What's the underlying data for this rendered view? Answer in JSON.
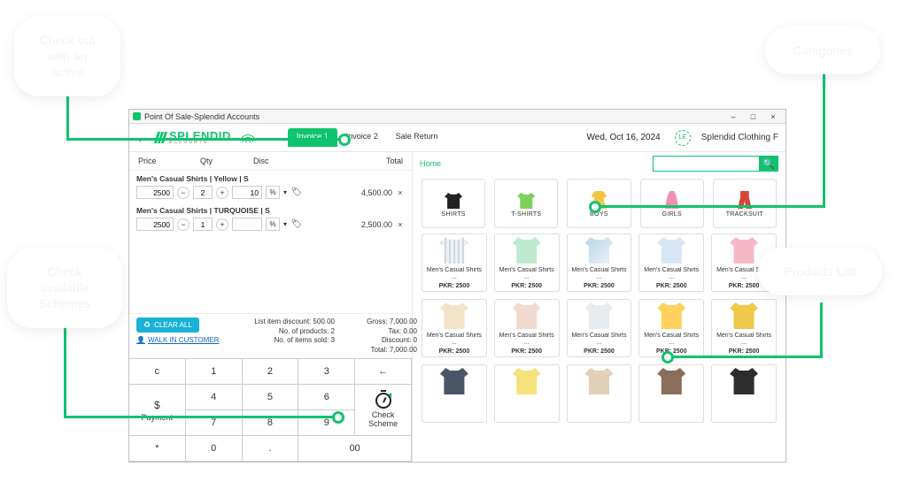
{
  "callouts": {
    "top_left": "Check out\nwith an active",
    "top_right": "Categories",
    "mid_left": "Check available\nSchemes",
    "mid_right": "Products List"
  },
  "window": {
    "title": "Point Of Sale-Splendid Accounts",
    "min": "–",
    "max": "□",
    "close": "×"
  },
  "header": {
    "back": "←",
    "brand": "SPLENDID",
    "brand_sub": "ACCOUNTS",
    "tabs": [
      "Invoice 1",
      "Invoice 2",
      "Sale Return"
    ],
    "active_tab": 0,
    "date": "Wed, Oct 16, 2024",
    "merchant_badge": "LE",
    "merchant_name": "Splendid Clothing F"
  },
  "cart": {
    "columns": {
      "price": "Price",
      "qty": "Qty",
      "disc": "Disc",
      "total": "Total"
    },
    "items": [
      {
        "name": "Men's Casual Shirts | Yellow | S",
        "price": "2500",
        "qty": "2",
        "disc": "10",
        "disc_type": "%",
        "total": "4,500.00"
      },
      {
        "name": "Men's Casual Shirts | TURQUOISE | S",
        "price": "2500",
        "qty": "1",
        "disc": "",
        "disc_type": "%",
        "total": "2,500.00"
      }
    ]
  },
  "summary": {
    "clear_all": "CLEAR ALL",
    "customer": "WALK IN CUSTOMER",
    "mid": {
      "list_disc_label": "List item discount:",
      "list_disc_value": "500.00",
      "num_products_label": "No. of products:",
      "num_products_value": "2",
      "items_sold_label": "No. of items sold:",
      "items_sold_value": "3"
    },
    "right": {
      "gross_label": "Gross:",
      "gross_value": "7,000.00",
      "tax_label": "Tax:",
      "tax_value": "0.00",
      "discount_label": "Discount:",
      "discount_value": "0",
      "total_label": "Total:",
      "total_value": "7,000.00"
    }
  },
  "keypad": {
    "keys": [
      "c",
      "1",
      "2",
      "3",
      "←",
      "4",
      "5",
      "6",
      "7",
      "8",
      "9",
      "*",
      "0",
      ".",
      "00"
    ],
    "payment": "Payment",
    "check_scheme": "Check\nScheme"
  },
  "breadcrumb": "Home",
  "search": {
    "placeholder": ""
  },
  "categories": [
    {
      "label": "SHIRTS"
    },
    {
      "label": "T-SHIRTS"
    },
    {
      "label": "BOYS"
    },
    {
      "label": "GIRLS"
    },
    {
      "label": "TRACKSUIT"
    }
  ],
  "products": [
    {
      "name": "Men's Casual Shirts ...",
      "price": "PKR: 2500"
    },
    {
      "name": "Men's Casual Shirts ...",
      "price": "PKR: 2500"
    },
    {
      "name": "Men's Casual Shirts ...",
      "price": "PKR: 2500"
    },
    {
      "name": "Men's Casual Shirts ...",
      "price": "PKR: 2500"
    },
    {
      "name": "Men's Casual Shirts ...",
      "price": "PKR: 2500"
    },
    {
      "name": "Men's Casual Shirts ...",
      "price": "PKR: 2500"
    },
    {
      "name": "Men's Casual Shirts ...",
      "price": "PKR: 2500"
    },
    {
      "name": "Men's Casual Shirts ...",
      "price": "PKR: 2500"
    },
    {
      "name": "Men's Casual Shirts ...",
      "price": "PKR: 2500"
    },
    {
      "name": "Men's Casual Shirts ...",
      "price": "PKR: 2500"
    },
    {
      "name": "",
      "price": ""
    },
    {
      "name": "",
      "price": ""
    },
    {
      "name": "",
      "price": ""
    },
    {
      "name": "",
      "price": ""
    },
    {
      "name": "",
      "price": ""
    }
  ]
}
